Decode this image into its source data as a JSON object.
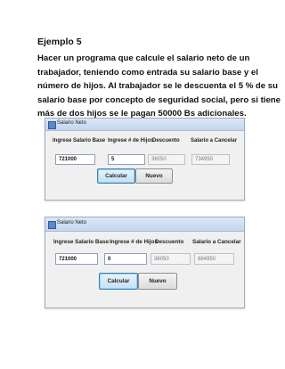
{
  "doc": {
    "heading": "Ejemplo 5",
    "paragraph_lines": [
      "Hacer un programa que calcule el salario neto de un",
      "trabajador, teniendo como entrada su salario base y el",
      "número de hijos. Al trabajador se le descuenta el 5 % de su",
      "salario base por concepto de seguridad social, pero si tiene",
      "más de dos hijos  se le pagan 50000 Bs adicionales."
    ]
  },
  "window1": {
    "title": "Salario Neto",
    "labels": {
      "salario": "Ingrese Salario Base",
      "hijos": "Ingrese # de Hijos",
      "descuento": "Descuento",
      "cancelar": "Salario a Cancelar"
    },
    "values": {
      "salario": "721000",
      "hijos": "5",
      "descuento": "36050",
      "cancelar": "734950"
    },
    "buttons": {
      "calcular": "Calcular",
      "nuevo": "Nuevo"
    }
  },
  "window2": {
    "title": "Salario Neto",
    "labels": {
      "salario": "Ingrese Salario Base",
      "hijos": "Ingrese # de Hijos",
      "descuento": "Descuento",
      "cancelar": "Salario a Cancelar"
    },
    "values": {
      "salario": "721000",
      "hijos": "0",
      "descuento": "36050",
      "cancelar": "684950"
    },
    "buttons": {
      "calcular": "Calcular",
      "nuevo": "Nuevo"
    }
  }
}
